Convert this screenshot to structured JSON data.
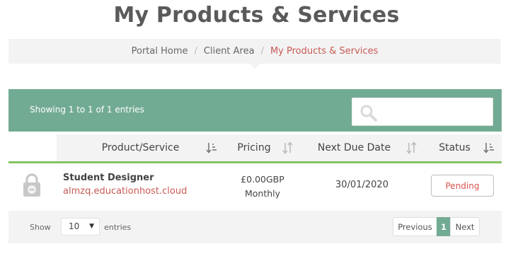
{
  "page": {
    "title": "My Products & Services"
  },
  "breadcrumb": [
    {
      "label": "Portal Home"
    },
    {
      "label": "Client Area"
    },
    {
      "label": "My Products & Services"
    }
  ],
  "breadcrumb_separator": "/",
  "table": {
    "info": "Showing 1 to 1 of 1 entries",
    "search": {
      "value": "",
      "placeholder": ""
    },
    "columns": [
      {
        "label": "Product/Service"
      },
      {
        "label": "Pricing"
      },
      {
        "label": "Next Due Date"
      },
      {
        "label": "Status"
      }
    ],
    "rows": [
      {
        "icon": "lock-icon",
        "product": "Student Designer",
        "domain": "almzq.educationhost.cloud",
        "price": "£0.00GBP",
        "cycle": "Monthly",
        "due_date": "30/01/2020",
        "status": "Pending"
      }
    ],
    "length": {
      "show_label": "Show",
      "value": "10",
      "entries_label": "entries"
    },
    "pagination": {
      "previous": "Previous",
      "current": "1",
      "next": "Next"
    }
  },
  "colors": {
    "accent": "#72ab93",
    "underline": "#86c263",
    "link": "#c85a54",
    "pending": "#d9534f"
  }
}
